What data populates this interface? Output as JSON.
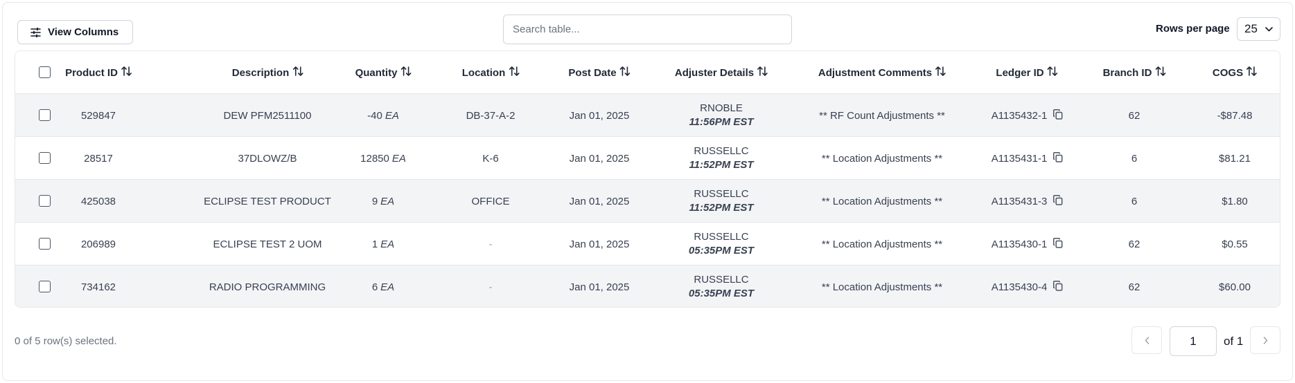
{
  "toolbar": {
    "view_columns_label": "View Columns",
    "search_placeholder": "Search table...",
    "rows_per_page_label": "Rows per page",
    "rows_per_page_value": "25"
  },
  "columns": [
    "Product ID",
    "Description",
    "Quantity",
    "Location",
    "Post Date",
    "Adjuster Details",
    "Adjustment Comments",
    "Ledger ID",
    "Branch ID",
    "COGS"
  ],
  "rows": [
    {
      "product_id": "529847",
      "description": "DEW PFM2511100",
      "qty": "-40",
      "uom": "EA",
      "location": "DB-37-A-2",
      "post_date": "Jan 01, 2025",
      "adjuster": "RNOBLE",
      "adj_time": "11:56PM EST",
      "comment": "** RF Count Adjustments **",
      "ledger": "A1135432-1",
      "branch": "62",
      "cogs": "-$87.48"
    },
    {
      "product_id": "28517",
      "description": "37DLOWZ/B",
      "qty": "12850",
      "uom": "EA",
      "location": "K-6",
      "post_date": "Jan 01, 2025",
      "adjuster": "RUSSELLC",
      "adj_time": "11:52PM EST",
      "comment": "** Location Adjustments **",
      "ledger": "A1135431-1",
      "branch": "6",
      "cogs": "$81.21"
    },
    {
      "product_id": "425038",
      "description": "ECLIPSE TEST PRODUCT",
      "qty": "9",
      "uom": "EA",
      "location": "OFFICE",
      "post_date": "Jan 01, 2025",
      "adjuster": "RUSSELLC",
      "adj_time": "11:52PM EST",
      "comment": "** Location Adjustments **",
      "ledger": "A1135431-3",
      "branch": "6",
      "cogs": "$1.80"
    },
    {
      "product_id": "206989",
      "description": "ECLIPSE TEST 2 UOM",
      "qty": "1",
      "uom": "EA",
      "location": "-",
      "post_date": "Jan 01, 2025",
      "adjuster": "RUSSELLC",
      "adj_time": "05:35PM EST",
      "comment": "** Location Adjustments **",
      "ledger": "A1135430-1",
      "branch": "62",
      "cogs": "$0.55"
    },
    {
      "product_id": "734162",
      "description": "RADIO PROGRAMMING",
      "qty": "6",
      "uom": "EA",
      "location": "-",
      "post_date": "Jan 01, 2025",
      "adjuster": "RUSSELLC",
      "adj_time": "05:35PM EST",
      "comment": "** Location Adjustments **",
      "ledger": "A1135430-4",
      "branch": "62",
      "cogs": "$60.00"
    }
  ],
  "footer": {
    "selection_text": "0 of 5 row(s) selected.",
    "page_value": "1",
    "page_of": "of 1"
  },
  "icons": {
    "columns": "sliders-icon",
    "sort": "sort-arrows-icon",
    "copy": "copy-icon",
    "select": "chevron-down-icon",
    "prev": "chevron-left-icon",
    "next": "chevron-right-icon"
  },
  "colors": {
    "row_shade": "#f3f4f6",
    "border": "#e5e7eb",
    "muted_text": "#6b7280"
  }
}
